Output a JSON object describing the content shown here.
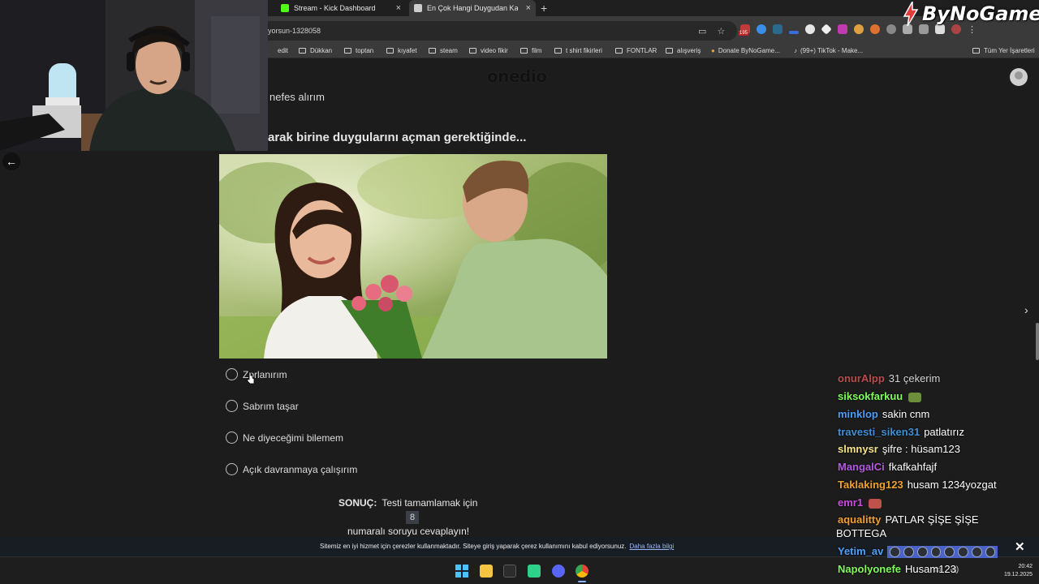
{
  "browser": {
    "tabs": [
      {
        "title": "Stream - Kick Dashboard"
      },
      {
        "title": "En Çok Hangi Duygudan Kaçıyo"
      }
    ],
    "url": "yorsun-1328058",
    "bookmarks": [
      "edit",
      "Dükkan",
      "toptan",
      "kıyafet",
      "steam",
      "video fikir",
      "film",
      "t shirt fikirleri",
      "FONTLAR",
      "alışveriş",
      "Donate ByNoGame...",
      "(99+) TikTok - Make...",
      "Tüm Yer İşaretleri"
    ],
    "ext_badge": "195"
  },
  "site": {
    "logo": "onedio",
    "previous_answer": "nefes alırım",
    "question": "arak birine duygularını açman gerektiğinde...",
    "options": [
      "Zorlanırım",
      "Sabrım taşar",
      "Ne diyeceğimi bilemem",
      "Açık davranmaya çalışırım"
    ],
    "result_label": "SONUÇ:",
    "result_text_1": "Testi tamamlamak için",
    "result_number": "8",
    "result_text_2": "numaralı soruyu cevaplayın!",
    "cookie_text": "Sitemiz en iyi hizmet için çerezler kullanmaktadır. Siteye giriş yaparak çerez kullanımını kabul ediyorsunuz.",
    "cookie_link": "Daha fazla bilgi"
  },
  "chat": {
    "messages": [
      {
        "user": "onurAlpp",
        "color": "#e05a5a",
        "text": "31 çekerim"
      },
      {
        "user": "siksokfarkuu",
        "color": "#7dfc5a",
        "text": "",
        "emote": "#6c8f3a"
      },
      {
        "user": "minklop",
        "color": "#4f9cf7",
        "text": "sakin cnm"
      },
      {
        "user": "travesti_siken31",
        "color": "#3f8fd6",
        "text": "patlatırız"
      },
      {
        "user": "slmnysr",
        "color": "#f5e28a",
        "text": "şifre : hüsam123"
      },
      {
        "user": "MangalCi",
        "color": "#b25ae0",
        "text": "fkafkahfajf"
      },
      {
        "user": "Taklaking123",
        "color": "#f0a030",
        "text": "husam 1234yozgat"
      },
      {
        "user": "emr1",
        "color": "#c84fe0",
        "text": "",
        "emote": "#c0504a"
      },
      {
        "user": "aqualitty",
        "color": "#f0a030",
        "text": "PATLAR ŞİŞE ŞİŞE"
      },
      {
        "user": "",
        "color": "#ffffff",
        "text": "BOTTEGA"
      },
      {
        "user": "Yetim_av",
        "color": "#4fa0f7",
        "text": "",
        "emote_row": true
      },
      {
        "user": "Napolyonefe",
        "color": "#7dfc5a",
        "text": "Husam123"
      }
    ]
  },
  "overlay": {
    "brand": "ByNoGame"
  },
  "taskbar": {
    "time": "20:42",
    "date": "19.12.2025"
  },
  "colors": {
    "page_bg": "#1c1c1c",
    "cookie_bg": "#181c23",
    "link": "#9ab8ff"
  }
}
